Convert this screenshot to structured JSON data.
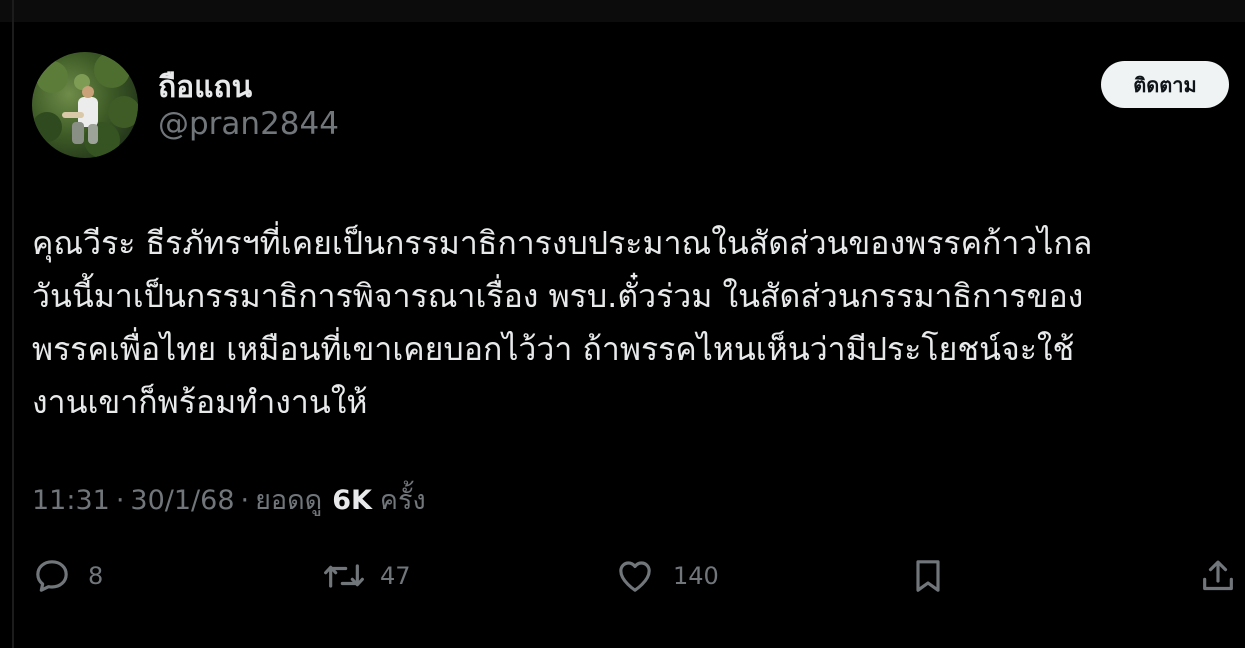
{
  "author": {
    "display_name": "ถือแถน",
    "handle": "@pran2844",
    "avatar_icon": "profile-photo"
  },
  "follow_button": {
    "label": "ติดตาม"
  },
  "tweet": {
    "lines": [
      "คุณวีระ ธีรภัทรฯที่เคยเป็นกรรมาธิการงบประมาณในสัดส่วนของพรรคก้าวไกล",
      "วันนี้มาเป็นกรรมาธิการพิจารณาเรื่อง พรบ.ตั๋วร่วม ในสัดส่วนกรรมาธิการของ",
      "พรรคเพื่อไทย เหมือนที่เขาเคยบอกไว้ว่า ถ้าพรรคไหนเห็นว่ามีประโยชน์จะใช้",
      "งานเขาก็พร้อมทำงานให้"
    ]
  },
  "meta": {
    "time": "11:31",
    "separator": "·",
    "date": "30/1/68",
    "views_label": "ยอดดู",
    "views_count": "6K",
    "views_suffix": "ครั้ง"
  },
  "actions": {
    "reply": {
      "icon": "reply-icon",
      "count": "8"
    },
    "repost": {
      "icon": "repost-icon",
      "count": "47"
    },
    "like": {
      "icon": "heart-icon",
      "count": "140"
    },
    "bookmark": {
      "icon": "bookmark-icon"
    },
    "share": {
      "icon": "share-icon"
    }
  },
  "colors": {
    "background": "#000000",
    "primary_text": "#e7e9ea",
    "secondary_text": "#71767b",
    "follow_bg": "#eff3f4"
  }
}
